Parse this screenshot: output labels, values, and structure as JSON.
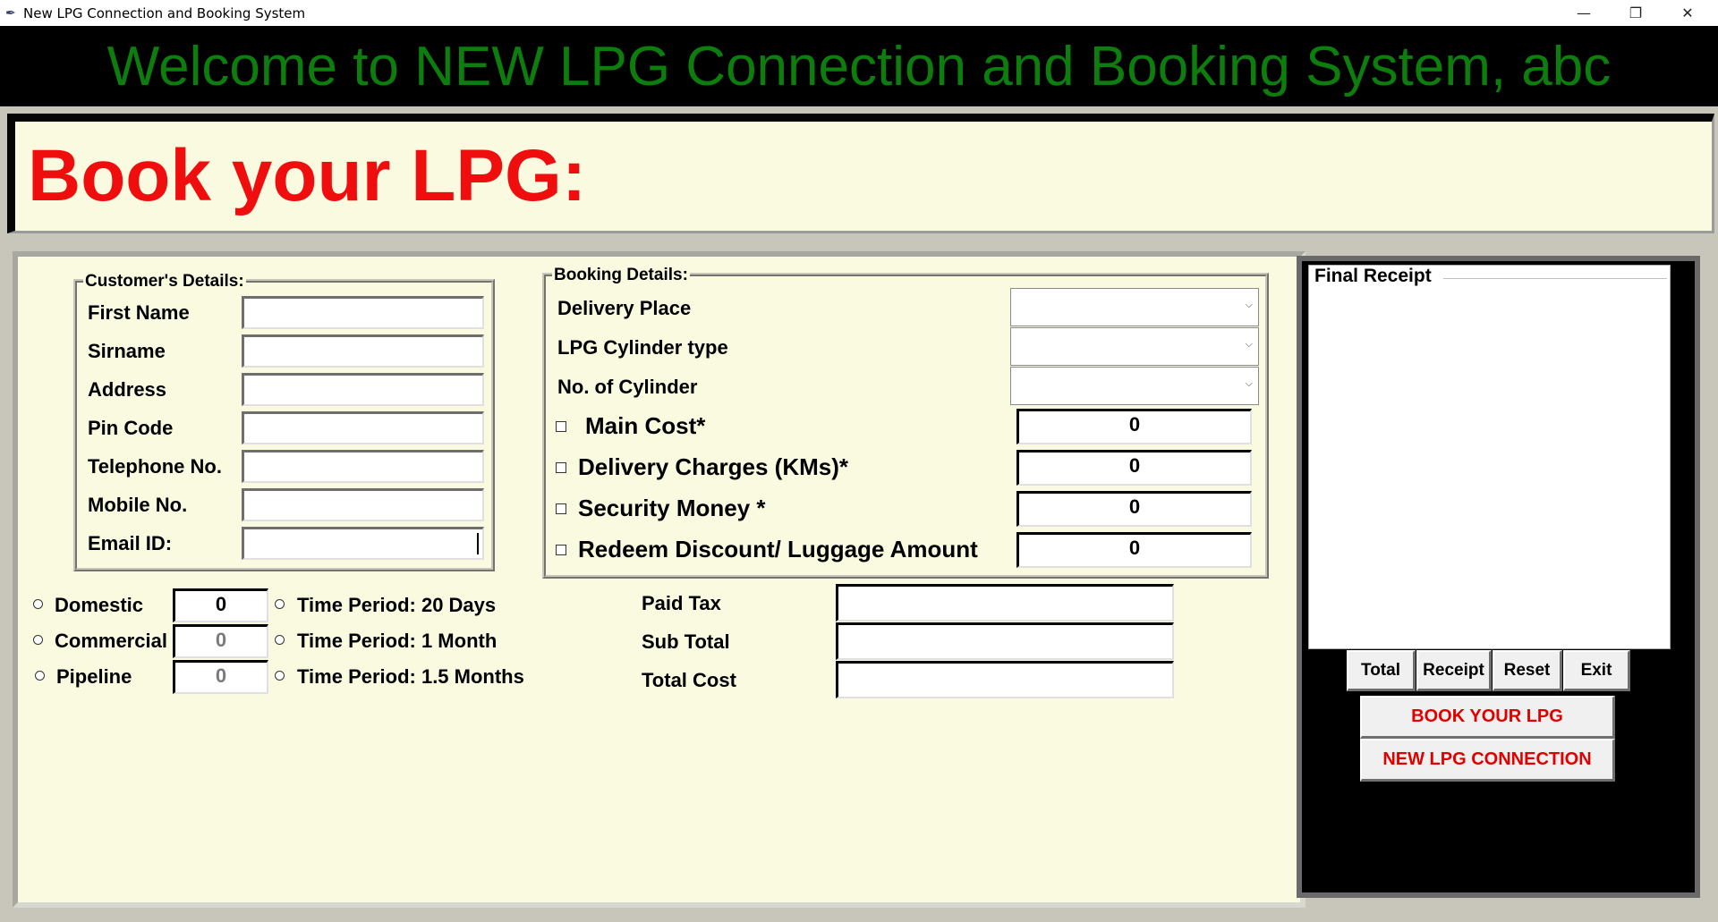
{
  "window": {
    "title": "New LPG Connection and Booking System",
    "icon": "feather-icon",
    "minimize": "—",
    "restore": "❐",
    "close": "✕"
  },
  "banner": {
    "welcome": "Welcome to NEW LPG Connection and Booking System, abc"
  },
  "header": {
    "title": "Book your LPG:"
  },
  "customer": {
    "legend": "Customer's Details:",
    "fields": [
      {
        "label": "First Name",
        "value": ""
      },
      {
        "label": "Sirname",
        "value": ""
      },
      {
        "label": "Address",
        "value": ""
      },
      {
        "label": "Pin Code",
        "value": ""
      },
      {
        "label": "Telephone No.",
        "value": ""
      },
      {
        "label": "Mobile No.",
        "value": ""
      },
      {
        "label": "Email ID:",
        "value": ""
      }
    ]
  },
  "booking": {
    "legend": "Booking Details:",
    "combos": [
      {
        "label": "Delivery Place",
        "value": ""
      },
      {
        "label": "LPG Cylinder type",
        "value": ""
      },
      {
        "label": "No. of Cylinder",
        "value": ""
      }
    ],
    "charges": [
      {
        "label": "Main Cost*",
        "value": "0"
      },
      {
        "label": "Delivery Charges (KMs)*",
        "value": "0"
      },
      {
        "label": "Security Money *",
        "value": "0"
      },
      {
        "label": "Redeem Discount/ Luggage Amount",
        "value": "0"
      }
    ]
  },
  "connection_types": [
    {
      "label": "Domestic",
      "value": "0"
    },
    {
      "label": "Commercial",
      "value": "0"
    },
    {
      "label": "Pipeline",
      "value": "0"
    }
  ],
  "time_periods": [
    {
      "label": "Time Period: 20 Days"
    },
    {
      "label": "Time Period: 1 Month"
    },
    {
      "label": "Time Period: 1.5 Months"
    }
  ],
  "totals": [
    {
      "label": "Paid Tax",
      "value": ""
    },
    {
      "label": "Sub Total",
      "value": ""
    },
    {
      "label": "Total Cost",
      "value": ""
    }
  ],
  "receipt": {
    "legend": "Final Receipt",
    "content": ""
  },
  "buttons": {
    "total": "Total",
    "receipt": "Receipt",
    "reset": "Reset",
    "exit": "Exit",
    "book": "BOOK YOUR LPG",
    "new_connection": "NEW LPG CONNECTION"
  },
  "colors": {
    "banner_text": "#0d7e0d",
    "title_text": "#f00d0d",
    "panel_bg": "#fafae0",
    "accent_red": "#e00000"
  }
}
